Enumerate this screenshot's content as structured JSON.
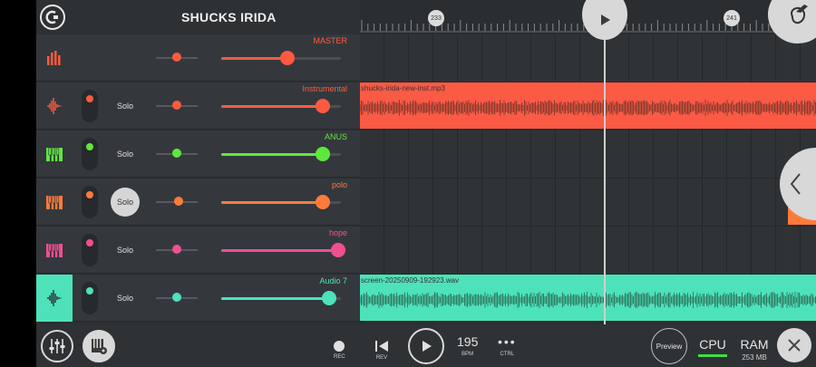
{
  "header": {
    "project_title": "SHUCKS IRIDA",
    "markers": [
      "233",
      "241"
    ]
  },
  "tracks": [
    {
      "name": "MASTER",
      "color": "#ff5a40",
      "icon": "equalizer-icon",
      "has_mute": false,
      "solo_label": "",
      "solo_active": false,
      "pan": 0.5,
      "volume": 0.55,
      "selected": false
    },
    {
      "name": "Instrumental",
      "color": "#ff5a40",
      "icon": "waveform-icon",
      "has_mute": true,
      "solo_label": "Solo",
      "solo_active": false,
      "pan": 0.5,
      "volume": 0.85,
      "selected": false,
      "clip": {
        "name": "shucks-irida-new-inst.mp3",
        "color": "#fb5a45",
        "wave": "#8a3a2e"
      }
    },
    {
      "name": "ANUS",
      "color": "#5ee83e",
      "icon": "piano-icon",
      "has_mute": true,
      "solo_label": "Solo",
      "solo_active": false,
      "pan": 0.5,
      "volume": 0.85,
      "selected": false
    },
    {
      "name": "polo",
      "color": "#ff7b3b",
      "icon": "piano-icon",
      "has_mute": true,
      "solo_label": "Solo",
      "solo_active": true,
      "pan": 0.55,
      "volume": 0.85,
      "selected": false
    },
    {
      "name": "hope",
      "color": "#f0508f",
      "icon": "piano-icon",
      "has_mute": true,
      "solo_label": "Solo",
      "solo_active": false,
      "pan": 0.5,
      "volume": 0.98,
      "selected": false
    },
    {
      "name": "Audio 7",
      "color": "#4de2b9",
      "icon": "waveform-icon",
      "has_mute": true,
      "solo_label": "Solo",
      "solo_active": false,
      "pan": 0.5,
      "volume": 0.9,
      "selected": true,
      "clip": {
        "name": "screen-20250909-192923.wav",
        "color": "#4de2b9",
        "wave": "#2f7d68"
      }
    }
  ],
  "bottom": {
    "rec_label": "REC",
    "rev_label": "REV",
    "bpm_value": "195",
    "bpm_label": "BPM",
    "ctrl_label": "CTRL",
    "preview_label": "Preview",
    "cpu_label": "CPU",
    "cpu_color": "#3ede4a",
    "ram_label": "RAM",
    "ram_value": "253 MB"
  }
}
